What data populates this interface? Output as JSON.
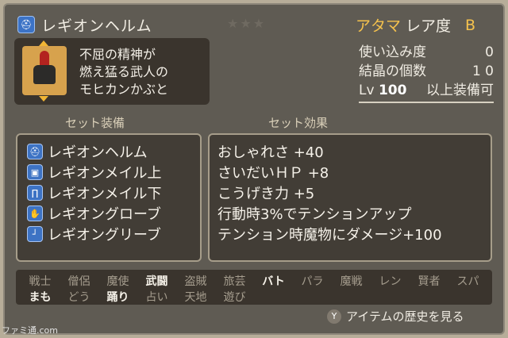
{
  "item": {
    "name": "レギオンヘルム",
    "icon": "helm-icon",
    "stars": "★★★",
    "slot": "アタマ",
    "rarity_label": "レア度",
    "rarity_rank": "B",
    "description": [
      "不屈の精神が",
      "燃え猛る武人の",
      "モヒカンかぶと"
    ]
  },
  "stats": {
    "usage_label": "使い込み度",
    "usage_value": "0",
    "crystal_label": "結晶の個数",
    "crystal_value": "1 0",
    "level_prefix": "Lv",
    "level_value": "100",
    "level_suffix": "以上装備可"
  },
  "sections": {
    "set_equipment": "セット装備",
    "set_effects": "セット効果"
  },
  "set_items": [
    {
      "icon": "helm-icon",
      "name": "レギオンヘルム"
    },
    {
      "icon": "body-armor-icon",
      "name": "レギオンメイル上"
    },
    {
      "icon": "leg-armor-icon",
      "name": "レギオンメイル下"
    },
    {
      "icon": "glove-icon",
      "name": "レギオングローブ"
    },
    {
      "icon": "boot-icon",
      "name": "レギオングリーブ"
    }
  ],
  "set_effects": [
    "おしゃれさ +40",
    "さいだいＨＰ +8",
    "こうげき力 +5",
    "行動時3%でテンションアップ",
    "テンション時魔物にダメージ+100"
  ],
  "jobs_row1": [
    {
      "label": "戦士",
      "on": false
    },
    {
      "label": "僧侶",
      "on": false
    },
    {
      "label": "魔使",
      "on": false
    },
    {
      "label": "武闘",
      "on": true
    },
    {
      "label": "盗賊",
      "on": false
    },
    {
      "label": "旅芸",
      "on": false
    },
    {
      "label": "バト",
      "on": true
    },
    {
      "label": "パラ",
      "on": false
    },
    {
      "label": "魔戦",
      "on": false
    },
    {
      "label": "レン",
      "on": false
    },
    {
      "label": "賢者",
      "on": false
    },
    {
      "label": "スパ",
      "on": false
    }
  ],
  "jobs_row2": [
    {
      "label": "まも",
      "on": true
    },
    {
      "label": "どう",
      "on": false
    },
    {
      "label": "踊り",
      "on": true
    },
    {
      "label": "占い",
      "on": false
    },
    {
      "label": "天地",
      "on": false
    },
    {
      "label": "遊び",
      "on": false
    }
  ],
  "history": {
    "button": "Y",
    "label": "アイテムの歴史を見る"
  },
  "watermark": "ファミ通.com"
}
